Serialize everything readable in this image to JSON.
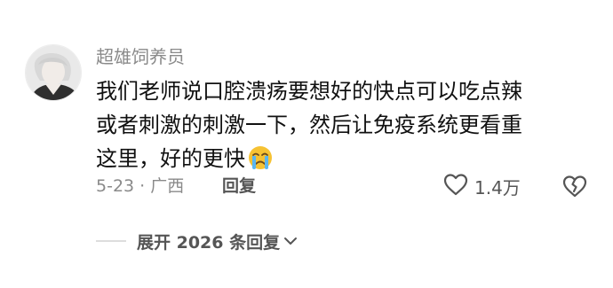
{
  "comment": {
    "username": "超雄饲养员",
    "text_lines": [
      "我们老师说口腔溃疡要想好的快点可以吃点辣",
      "或者刺激的刺激一下，然后让免疫系统更看重",
      "这里，好的更快"
    ],
    "emoji": "crying-face",
    "date": "5-23",
    "separator": "·",
    "location": "广西",
    "reply_label": "回复",
    "like_count": "1.4万"
  },
  "replies": {
    "expand_label": "展开 2026 条回复"
  },
  "colors": {
    "text_primary": "#111111",
    "text_secondary": "#8a8a8a",
    "text_action": "#555555",
    "divider": "#dddddd",
    "emoji_face": "#f6c233"
  }
}
